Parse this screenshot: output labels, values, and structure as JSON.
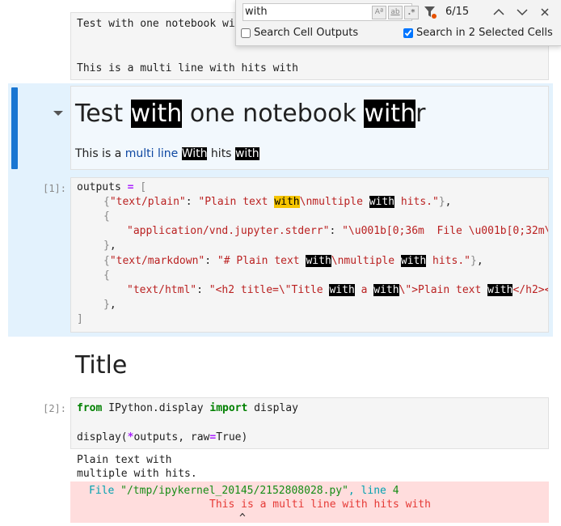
{
  "find": {
    "query": "with",
    "count": "6/15",
    "search_outputs_label": "Search Cell Outputs",
    "search_outputs_checked": false,
    "search_selected_label": "Search in 2 Selected Cells",
    "search_selected_checked": true
  },
  "cell0": {
    "line1": "Test with one notebook wi",
    "line3": "This is a multi line with hits with"
  },
  "md_cell": {
    "heading": [
      "Test ",
      "with",
      " one notebook ",
      "with",
      "r"
    ],
    "para_prefix": "This is a ",
    "para_link": "multi line",
    "para_w1": "With",
    "para_mid": " hits ",
    "para_w2": "with"
  },
  "code1": {
    "prompt": "[1]:",
    "l1": [
      "outputs",
      " = ",
      "["
    ],
    "l2": [
      "{",
      "\"text/plain\"",
      ": ",
      "\"Plain text ",
      "with",
      "\\nmultiple ",
      "with",
      " hits.\"",
      "}",
      ","
    ],
    "l3": "{",
    "l4": [
      "\"application/vnd.jupyter.stderr\"",
      ": ",
      "\"\\u001b[0;36m  File \\u001b[0;32m\\"
    ],
    "l5": [
      "}",
      ","
    ],
    "l6": [
      "{",
      "\"text/markdown\"",
      ": ",
      "\"# Plain text ",
      "with",
      "\\nmultiple ",
      "with",
      " hits.\"",
      "}",
      ","
    ],
    "l7": "{",
    "l8": [
      "\"text/html\"",
      ": ",
      "\"<h2 title=\\\"Title ",
      "with",
      " a ",
      "with",
      "\\\">Plain text ",
      "with",
      "</h2><"
    ],
    "l9": [
      "}",
      ","
    ],
    "l10": "]"
  },
  "title_cell": {
    "text": "Title"
  },
  "code2": {
    "prompt": "[2]:",
    "l1": [
      "from",
      " IPython.display ",
      "import",
      " display"
    ],
    "l3": [
      "display(",
      "*",
      "outputs, raw",
      "=",
      "True)"
    ]
  },
  "output2": {
    "line1": "Plain text with",
    "line2": "multiple with hits.",
    "err_line1": [
      "File ",
      "\"/tmp/ipykernel_20145/2152808028.py\"",
      ", line ",
      "4"
    ],
    "err_line2": "This is a multi line with hits with",
    "err_caret": "^"
  },
  "colors": {
    "active_bar": "#1976d2",
    "active_bg": "#e3f2fd",
    "match": "#000000",
    "current_match": "#f5c400",
    "error_bg": "#fdd"
  }
}
